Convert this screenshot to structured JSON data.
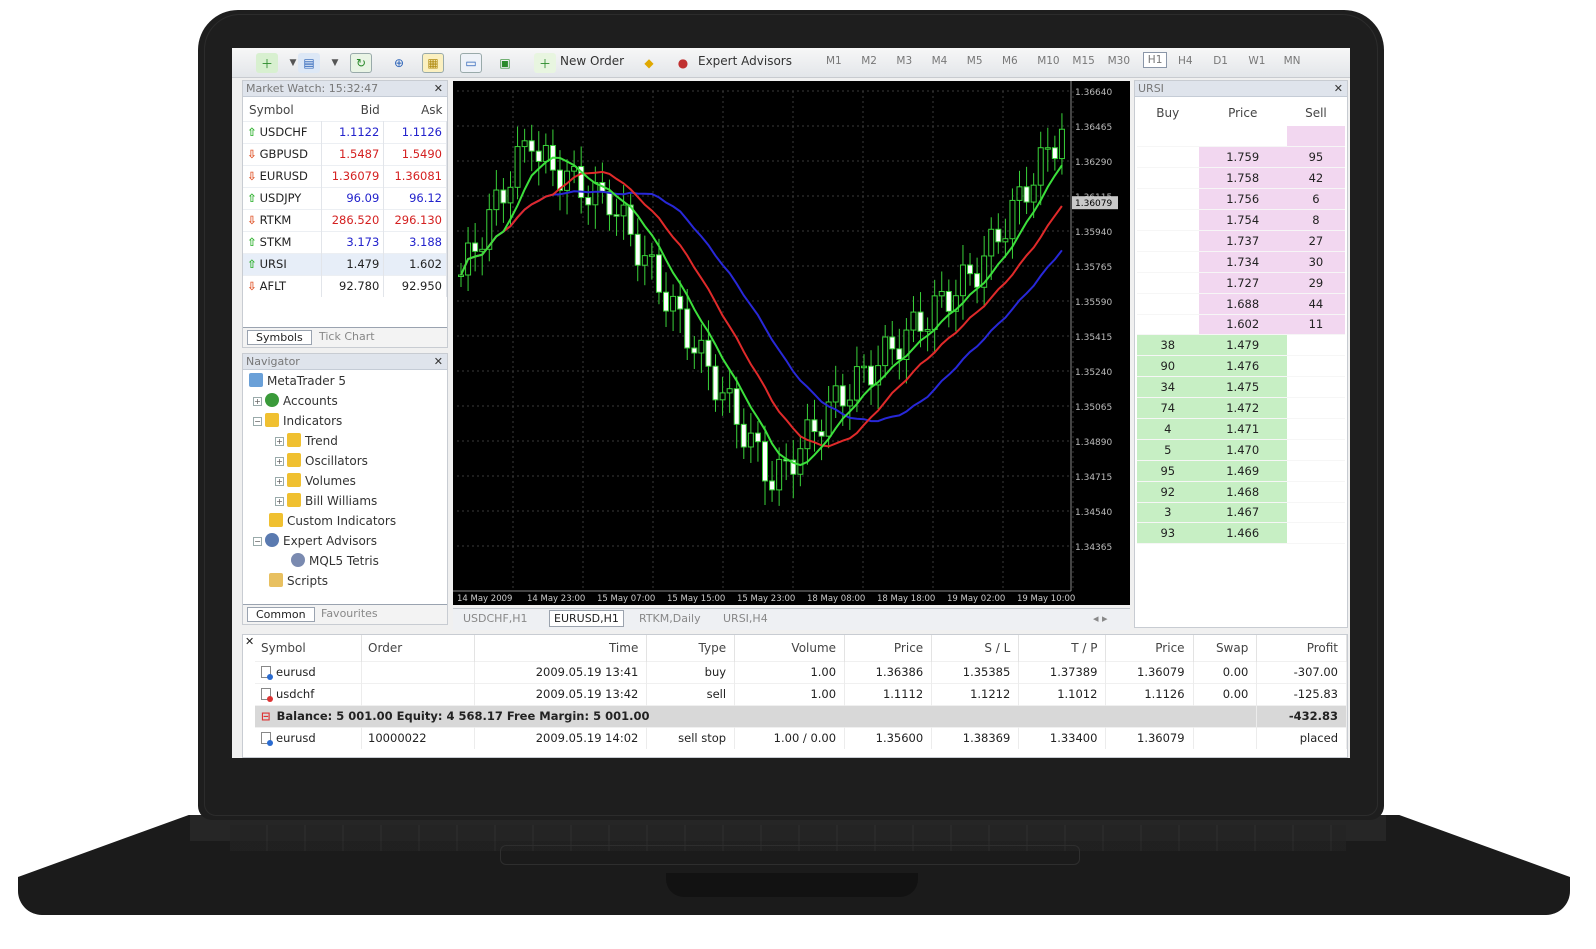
{
  "toolbar": {
    "new_order": "New Order",
    "expert_advisors": "Expert Advisors",
    "timeframes": [
      "M1",
      "M2",
      "M3",
      "M4",
      "M5",
      "M6",
      "M10",
      "M15",
      "M30",
      "H1",
      "H4",
      "D1",
      "W1",
      "MN"
    ],
    "active_timeframe": "H1"
  },
  "market_watch": {
    "title": "Market Watch: 15:32:47",
    "columns": [
      "Symbol",
      "Bid",
      "Ask"
    ],
    "rows": [
      {
        "dir": "up",
        "symbol": "USDCHF",
        "bid": "1.1122",
        "ask": "1.1126",
        "color": "blue"
      },
      {
        "dir": "down",
        "symbol": "GBPUSD",
        "bid": "1.5487",
        "ask": "1.5490",
        "color": "red"
      },
      {
        "dir": "down",
        "symbol": "EURUSD",
        "bid": "1.36079",
        "ask": "1.36081",
        "color": "red"
      },
      {
        "dir": "up",
        "symbol": "USDJPY",
        "bid": "96.09",
        "ask": "96.12",
        "color": "blue"
      },
      {
        "dir": "down",
        "symbol": "RTKM",
        "bid": "286.520",
        "ask": "296.130",
        "color": "red"
      },
      {
        "dir": "up",
        "symbol": "STKM",
        "bid": "3.173",
        "ask": "3.188",
        "color": "blue"
      },
      {
        "dir": "up",
        "symbol": "URSI",
        "bid": "1.479",
        "ask": "1.602",
        "color": "black"
      },
      {
        "dir": "down",
        "symbol": "AFLT",
        "bid": "92.780",
        "ask": "92.950",
        "color": "black"
      }
    ],
    "tabs": [
      "Symbols",
      "Tick Chart"
    ]
  },
  "navigator": {
    "title": "Navigator",
    "items": [
      "MetaTrader 5",
      "Accounts",
      "Indicators",
      "Trend",
      "Oscillators",
      "Volumes",
      "Bill Williams",
      "Custom Indicators",
      "Expert Advisors",
      "MQL5 Tetris",
      "Scripts"
    ],
    "tabs": [
      "Common",
      "Favourites"
    ]
  },
  "chart": {
    "price_labels": [
      "1.36640",
      "1.36465",
      "1.36290",
      "1.36115",
      "1.35940",
      "1.35765",
      "1.35590",
      "1.35415",
      "1.35240",
      "1.35065",
      "1.34890",
      "1.34715",
      "1.34540",
      "1.34365"
    ],
    "current_price": "1.36079",
    "time_labels": [
      "14 May 2009",
      "14 May 23:00",
      "15 May 07:00",
      "15 May 15:00",
      "15 May 23:00",
      "18 May 08:00",
      "18 May 18:00",
      "19 May 02:00",
      "19 May 10:00"
    ],
    "tabs": [
      "USDCHF,H1",
      "EURUSD,H1",
      "RTKM,Daily",
      "URSI,H4"
    ],
    "active_tab": "EURUSD,H1",
    "colors": {
      "background": "#000000",
      "grid": "#3a3a3a",
      "candle": "#39d239",
      "ma_fast": "#3ce03c",
      "ma_mid": "#e02a2a",
      "ma_slow": "#2828d8"
    }
  },
  "dom": {
    "title": "URSI",
    "columns": [
      "Buy",
      "Price",
      "Sell"
    ],
    "asks": [
      {
        "price": "1.759",
        "sell": "95"
      },
      {
        "price": "1.758",
        "sell": "42"
      },
      {
        "price": "1.756",
        "sell": "6"
      },
      {
        "price": "1.754",
        "sell": "8"
      },
      {
        "price": "1.737",
        "sell": "27"
      },
      {
        "price": "1.734",
        "sell": "30"
      },
      {
        "price": "1.727",
        "sell": "29"
      },
      {
        "price": "1.688",
        "sell": "44"
      },
      {
        "price": "1.602",
        "sell": "11"
      }
    ],
    "bids": [
      {
        "buy": "38",
        "price": "1.479"
      },
      {
        "buy": "90",
        "price": "1.476"
      },
      {
        "buy": "34",
        "price": "1.475"
      },
      {
        "buy": "74",
        "price": "1.472"
      },
      {
        "buy": "4",
        "price": "1.471"
      },
      {
        "buy": "5",
        "price": "1.470"
      },
      {
        "buy": "95",
        "price": "1.469"
      },
      {
        "buy": "92",
        "price": "1.468"
      },
      {
        "buy": "3",
        "price": "1.467"
      },
      {
        "buy": "93",
        "price": "1.466"
      }
    ]
  },
  "trade": {
    "columns": [
      "Symbol",
      "Order",
      "Time",
      "Type",
      "Volume",
      "Price",
      "S / L",
      "T / P",
      "Price",
      "Swap",
      "Profit"
    ],
    "rows": [
      {
        "symbol": "eurusd",
        "order": "",
        "time": "2009.05.19 13:41",
        "type": "buy",
        "volume": "1.00",
        "price": "1.36386",
        "sl": "1.35385",
        "tp": "1.37389",
        "cur": "1.36079",
        "swap": "0.00",
        "profit": "-307.00"
      },
      {
        "symbol": "usdchf",
        "order": "",
        "time": "2009.05.19 13:42",
        "type": "sell",
        "volume": "1.00",
        "price": "1.1112",
        "sl": "1.1212",
        "tp": "1.1012",
        "cur": "1.1126",
        "swap": "0.00",
        "profit": "-125.83"
      }
    ],
    "balance_text": "Balance: 5 001.00  Equity: 4 568.17  Free Margin: 5 001.00",
    "balance_profit": "-432.83",
    "pending": {
      "symbol": "eurusd",
      "order": "10000022",
      "time": "2009.05.19 14:02",
      "type": "sell stop",
      "volume": "1.00 / 0.00",
      "price": "1.35600",
      "sl": "1.38369",
      "tp": "1.33400",
      "cur": "1.36079",
      "swap": "",
      "profit": "placed"
    }
  }
}
